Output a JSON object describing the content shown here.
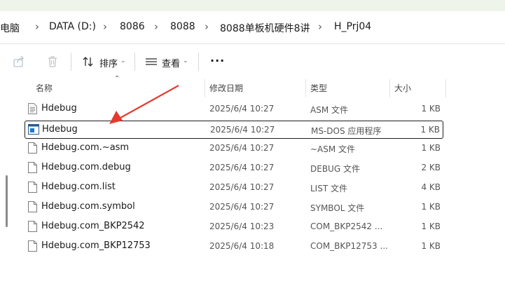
{
  "breadcrumb": {
    "items": [
      "电脑",
      "DATA (D:)",
      "8086",
      "8088",
      "8088单板机硬件8讲",
      "H_Prj04"
    ],
    "separator": "›"
  },
  "toolbar": {
    "sort_label": "排序",
    "view_label": "查看",
    "more_label": "···"
  },
  "columns": {
    "name": "名称",
    "date": "修改日期",
    "type": "类型",
    "size": "大小"
  },
  "files": [
    {
      "name": "Hdebug",
      "date": "2025/6/4 10:27",
      "type": "ASM 文件",
      "size": "1 KB",
      "icon": "text-file-icon",
      "selected": false
    },
    {
      "name": "Hdebug",
      "date": "2025/6/4 10:27",
      "type": "MS-DOS 应用程序",
      "size": "1 KB",
      "icon": "executable-icon",
      "selected": true
    },
    {
      "name": "Hdebug.com.~asm",
      "date": "2025/6/4 10:27",
      "type": "~ASM 文件",
      "size": "1 KB",
      "icon": "file-icon",
      "selected": false
    },
    {
      "name": "Hdebug.com.debug",
      "date": "2025/6/4 10:27",
      "type": "DEBUG 文件",
      "size": "2 KB",
      "icon": "file-icon",
      "selected": false
    },
    {
      "name": "Hdebug.com.list",
      "date": "2025/6/4 10:27",
      "type": "LIST 文件",
      "size": "4 KB",
      "icon": "file-icon",
      "selected": false
    },
    {
      "name": "Hdebug.com.symbol",
      "date": "2025/6/4 10:27",
      "type": "SYMBOL 文件",
      "size": "1 KB",
      "icon": "file-icon",
      "selected": false
    },
    {
      "name": "Hdebug.com_BKP2542",
      "date": "2025/6/4 10:23",
      "type": "COM_BKP2542 ...",
      "size": "1 KB",
      "icon": "file-icon",
      "selected": false
    },
    {
      "name": "Hdebug.com_BKP12753",
      "date": "2025/6/4 10:18",
      "type": "COM_BKP12753 ...",
      "size": "1 KB",
      "icon": "file-icon",
      "selected": false
    }
  ],
  "colors": {
    "arrow": "#e53a2f",
    "selection_border": "#1e1e1e",
    "header_strip": "#eef4e9"
  }
}
